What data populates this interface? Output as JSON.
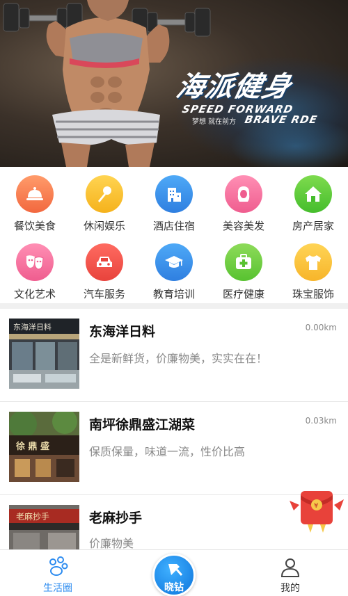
{
  "banner": {
    "title": "海派健身",
    "subtitle_line1": "SPEED FORWARD",
    "subtitle_line2": "BRAVE RDE",
    "slogan": "梦想 就在前方"
  },
  "categories": [
    {
      "label": "餐饮美食",
      "icon": "dining-cloche-icon",
      "color": "#f47a4a"
    },
    {
      "label": "休闲娱乐",
      "icon": "microphone-icon",
      "color": "#f7bf2f"
    },
    {
      "label": "酒店住宿",
      "icon": "building-icon",
      "color": "#3a8fe9"
    },
    {
      "label": "美容美发",
      "icon": "woman-hair-icon",
      "color": "#f36b9a"
    },
    {
      "label": "房产居家",
      "icon": "house-icon",
      "color": "#54c337"
    },
    {
      "label": "文化艺术",
      "icon": "theater-mask-icon",
      "color": "#f36b9a"
    },
    {
      "label": "汽车服务",
      "icon": "car-icon",
      "color": "#ec4c43"
    },
    {
      "label": "教育培训",
      "icon": "graduation-cap-icon",
      "color": "#3a8fe9"
    },
    {
      "label": "医疗健康",
      "icon": "medical-kit-icon",
      "color": "#5ec833"
    },
    {
      "label": "珠宝服饰",
      "icon": "tshirt-icon",
      "color": "#f7bb2d"
    }
  ],
  "stores": [
    {
      "name": "东海洋日料",
      "distance": "0.00km",
      "description": "全是新鲜货，价廉物美，实实在在！",
      "sign": "东海洋日料"
    },
    {
      "name": "南坪徐鼎盛江湖菜",
      "distance": "0.03km",
      "description": "保质保量，味道一流，性价比高",
      "sign": "徐 鼎 盛"
    },
    {
      "name": "老麻抄手",
      "distance": "",
      "description": "价廉物美",
      "sign": "老麻抄手"
    }
  ],
  "tabbar": {
    "home_label": "生活圈",
    "center_label": "晓钻",
    "me_label": "我的"
  },
  "colors": {
    "accent": "#2d8cf0",
    "divider": "#f0f0f0"
  }
}
